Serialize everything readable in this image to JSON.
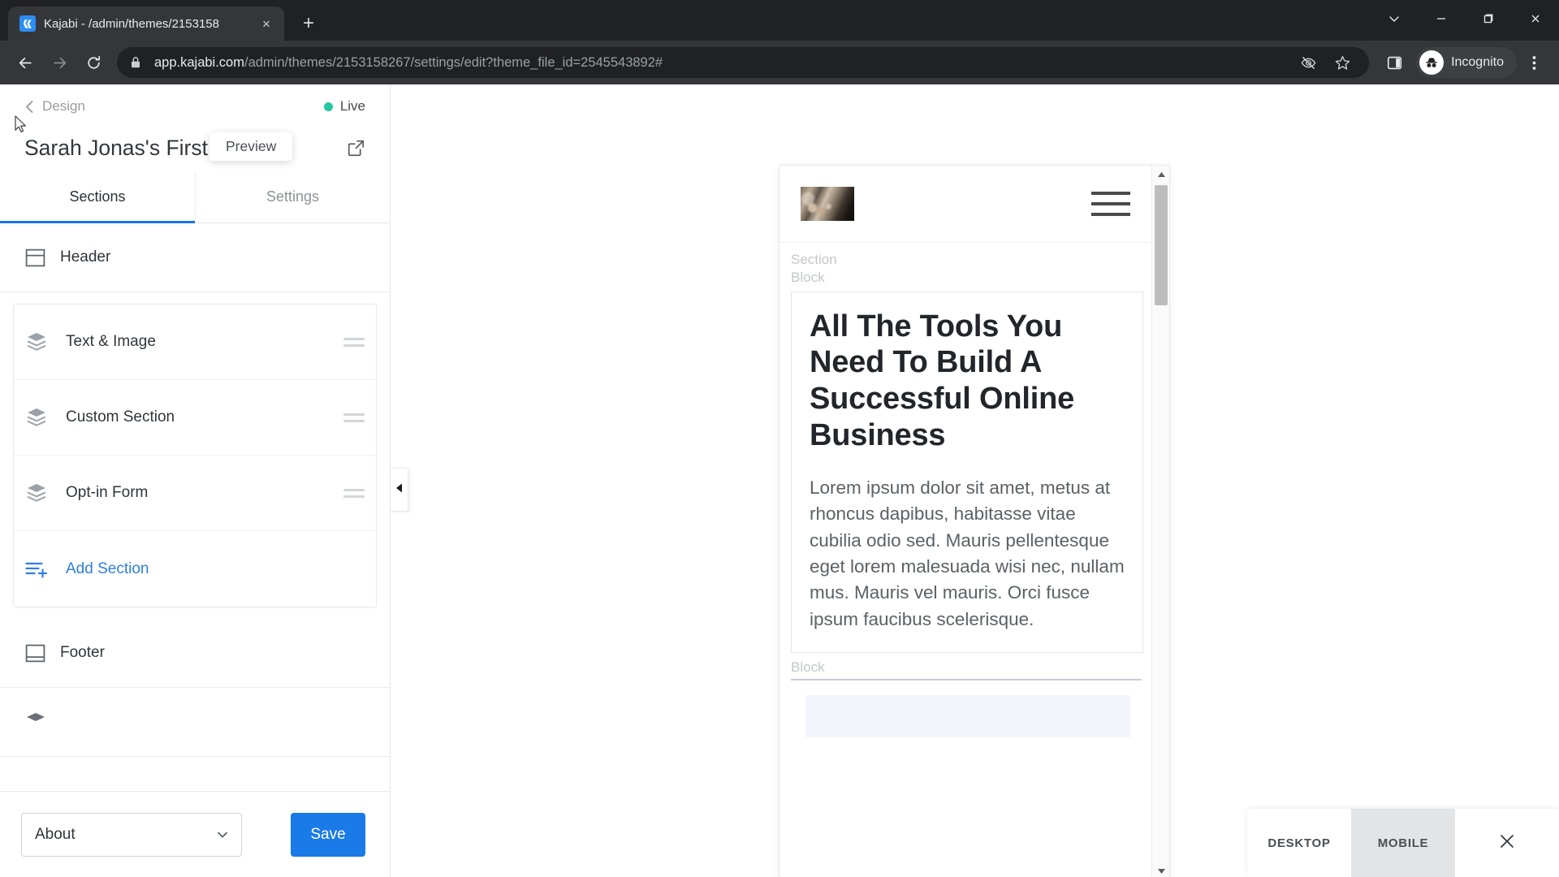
{
  "browser": {
    "tab": {
      "title": "Kajabi - /admin/themes/2153158",
      "favicon": "kajabi-logo-icon",
      "close": "×"
    },
    "new_tab_label": "+",
    "window_controls": [
      "tab-search-chevron-icon",
      "minimize-icon",
      "maximize-icon",
      "close-icon"
    ],
    "toolbar": {
      "back": "back-arrow-icon",
      "forward": "forward-arrow-icon",
      "reload": "reload-icon",
      "lock": "lock-icon",
      "url_domain": "app.kajabi.com",
      "url_path": "/admin/themes/2153158267/settings/edit?theme_file_id=2545543892#",
      "third_party_cookie": "eye-slash-icon",
      "bookmark": "star-icon",
      "side_panel": "side-panel-icon",
      "profile_label": "Incognito",
      "profile_icon": "incognito-hat-icon",
      "menu": "three-dot-menu-icon"
    }
  },
  "sidebar": {
    "back_label": "Design",
    "back_icon": "chevron-left-icon",
    "status_label": "Live",
    "status_color": "#27c6a2",
    "site_title": "Sarah Jonas's First Site",
    "external_link_icon": "external-link-icon",
    "tooltip": "Preview",
    "tabs": [
      {
        "label": "Sections",
        "active": true
      },
      {
        "label": "Settings",
        "active": false
      }
    ],
    "header_item": {
      "label": "Header",
      "icon": "header-layout-icon"
    },
    "sections": [
      {
        "label": "Text & Image",
        "icon": "layers-icon",
        "handle": "drag-handle-icon"
      },
      {
        "label": "Custom Section",
        "icon": "layers-icon",
        "handle": "drag-handle-icon"
      },
      {
        "label": "Opt-in Form",
        "icon": "layers-icon",
        "handle": "drag-handle-icon"
      },
      {
        "label": "Add Section",
        "icon": "add-section-icon",
        "is_link": true
      }
    ],
    "footer_item": {
      "label": "Footer",
      "icon": "footer-layout-icon"
    },
    "page_select_value": "About",
    "page_select_chevron": "chevron-down-icon",
    "save_label": "Save"
  },
  "collapse_handle_icon": "triangle-left-icon",
  "preview": {
    "logo": "site-logo-image",
    "menu_icon": "hamburger-menu-icon",
    "label_section": "Section",
    "label_block": "Block",
    "heading": "All The Tools You Need To Build A Successful Online Business",
    "paragraph": "Lorem ipsum dolor sit amet, metus at rhoncus dapibus, habitasse vitae cubilia odio sed. Mauris pellentesque eget lorem malesuada wisi nec, nullam mus. Mauris vel mauris. Orci fusce ipsum faucibus scelerisque.",
    "label_block_2": "Block",
    "scrollbar": {
      "up_arrow": "scroll-up-arrow-icon",
      "down_arrow": "scroll-down-arrow-icon"
    }
  },
  "device_bar": {
    "desktop_label": "DESKTOP",
    "mobile_label": "MOBILE",
    "active": "MOBILE",
    "close_icon": "close-icon"
  }
}
